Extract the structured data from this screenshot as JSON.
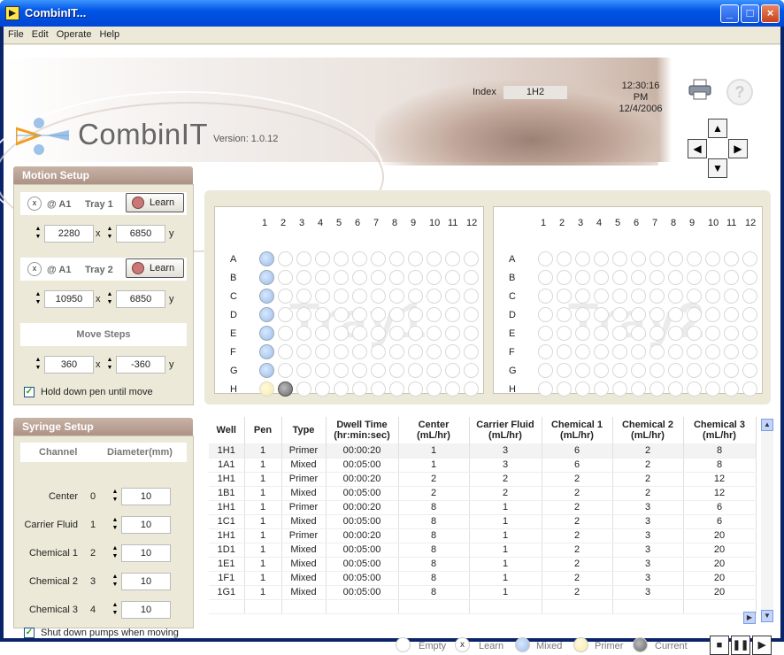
{
  "window": {
    "title": "CombinIT..."
  },
  "menu": [
    "File",
    "Edit",
    "Operate",
    "Help"
  ],
  "header": {
    "app_name": "CombinIT",
    "version": "Version: 1.0.12",
    "index_label": "Index",
    "index_value": "1H2",
    "time": "12:30:16 PM",
    "date": "12/4/2006"
  },
  "motion": {
    "title": "Motion Setup",
    "tray1": {
      "knob": "x",
      "at": "@ A1",
      "name": "Tray 1",
      "learn": "Learn",
      "x": "2280",
      "y": "6850"
    },
    "tray2": {
      "knob": "x",
      "at": "@ A1",
      "name": "Tray 2",
      "learn": "Learn",
      "x": "10950",
      "y": "6850"
    },
    "move_steps": "Move Steps",
    "steps_x": "360",
    "steps_y": "-360",
    "x_label": "x",
    "y_label": "y",
    "hold_pen": "Hold down pen until move"
  },
  "syringe": {
    "title": "Syringe Setup",
    "col_channel": "Channel",
    "col_diameter": "Diameter(mm)",
    "rows": [
      {
        "name": "Center",
        "idx": "0",
        "diam": "10"
      },
      {
        "name": "Carrier Fluid",
        "idx": "1",
        "diam": "10"
      },
      {
        "name": "Chemical 1",
        "idx": "2",
        "diam": "10"
      },
      {
        "name": "Chemical 2",
        "idx": "3",
        "diam": "10"
      },
      {
        "name": "Chemical 3",
        "idx": "4",
        "diam": "10"
      }
    ],
    "shutdown": "Shut down pumps when moving"
  },
  "trays": {
    "columns": [
      "1",
      "2",
      "3",
      "4",
      "5",
      "6",
      "7",
      "8",
      "9",
      "10",
      "11",
      "12"
    ],
    "rows": [
      "A",
      "B",
      "C",
      "D",
      "E",
      "F",
      "G",
      "H"
    ],
    "tray1_watermark": "Tray1",
    "tray2_watermark": "Tray2",
    "tray1_wells": {
      "mixed": [
        "A1",
        "B1",
        "C1",
        "D1",
        "E1",
        "F1",
        "G1"
      ],
      "primer": [
        "H1"
      ],
      "current": [
        "H2"
      ]
    }
  },
  "table": {
    "headers": [
      "Well",
      "Pen",
      "Type",
      "Dwell Time\n(hr:min:sec)",
      "Center\n(mL/hr)",
      "Carrier Fluid\n(mL/hr)",
      "Chemical 1\n(mL/hr)",
      "Chemical 2\n(mL/hr)",
      "Chemical 3\n(mL/hr)"
    ],
    "rows": [
      [
        "1H1",
        "1",
        "Primer",
        "00:00:20",
        "1",
        "3",
        "6",
        "2",
        "8"
      ],
      [
        "1A1",
        "1",
        "Mixed",
        "00:05:00",
        "1",
        "3",
        "6",
        "2",
        "8"
      ],
      [
        "1H1",
        "1",
        "Primer",
        "00:00:20",
        "2",
        "2",
        "2",
        "2",
        "12"
      ],
      [
        "1B1",
        "1",
        "Mixed",
        "00:05:00",
        "2",
        "2",
        "2",
        "2",
        "12"
      ],
      [
        "1H1",
        "1",
        "Primer",
        "00:00:20",
        "8",
        "1",
        "2",
        "3",
        "6"
      ],
      [
        "1C1",
        "1",
        "Mixed",
        "00:05:00",
        "8",
        "1",
        "2",
        "3",
        "6"
      ],
      [
        "1H1",
        "1",
        "Primer",
        "00:00:20",
        "8",
        "1",
        "2",
        "3",
        "20"
      ],
      [
        "1D1",
        "1",
        "Mixed",
        "00:05:00",
        "8",
        "1",
        "2",
        "3",
        "20"
      ],
      [
        "1E1",
        "1",
        "Mixed",
        "00:05:00",
        "8",
        "1",
        "2",
        "3",
        "20"
      ],
      [
        "1F1",
        "1",
        "Mixed",
        "00:05:00",
        "8",
        "1",
        "2",
        "3",
        "20"
      ],
      [
        "1G1",
        "1",
        "Mixed",
        "00:05:00",
        "8",
        "1",
        "2",
        "3",
        "20"
      ]
    ]
  },
  "legend": {
    "empty": "Empty",
    "learn_mark": "x",
    "learn": "Learn",
    "mixed": "Mixed",
    "primer": "Primer",
    "current": "Current"
  }
}
